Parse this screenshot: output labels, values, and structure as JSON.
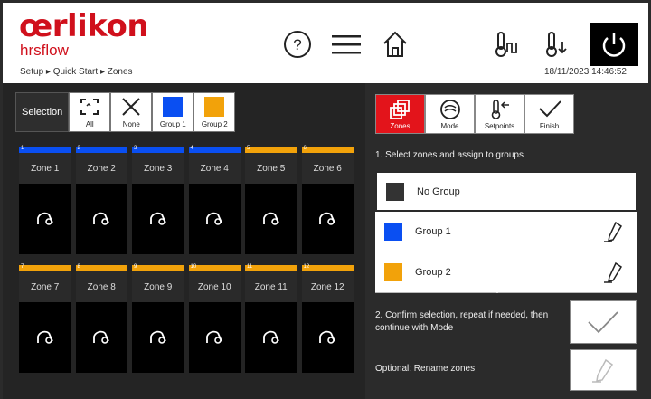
{
  "header": {
    "brand": "œrlikon",
    "product": "hrsflow",
    "breadcrumb": "Setup ▸ Quick Start ▸ Zones",
    "datetime": "18/11/2023 14:46:52"
  },
  "selection": {
    "label": "Selection",
    "buttons": [
      {
        "label": "All",
        "icon": "select-all-icon"
      },
      {
        "label": "None",
        "icon": "select-none-icon"
      },
      {
        "label": "Group 1",
        "color": "#0a4ff2"
      },
      {
        "label": "Group 2",
        "color": "#f2a20a"
      }
    ]
  },
  "colors": {
    "group1": "#0a4ff2",
    "group2": "#f2a20a",
    "accent": "#e3141b"
  },
  "zones": [
    {
      "num": "1",
      "label": "Zone 1",
      "group": "group1"
    },
    {
      "num": "2",
      "label": "Zone 2",
      "group": "group1"
    },
    {
      "num": "3",
      "label": "Zone 3",
      "group": "group1"
    },
    {
      "num": "4",
      "label": "Zone 4",
      "group": "group1"
    },
    {
      "num": "5",
      "label": "Zone 5",
      "group": "group2"
    },
    {
      "num": "6",
      "label": "Zone 6",
      "group": "group2"
    },
    {
      "num": "7",
      "label": "Zone 7",
      "group": "group2"
    },
    {
      "num": "8",
      "label": "Zone 8",
      "group": "group2"
    },
    {
      "num": "9",
      "label": "Zone 9",
      "group": "group2"
    },
    {
      "num": "10",
      "label": "Zone 10",
      "group": "group2"
    },
    {
      "num": "11",
      "label": "Zone 11",
      "group": "group2"
    },
    {
      "num": "12",
      "label": "Zone 12",
      "group": "group2"
    }
  ],
  "tabs": [
    {
      "label": "Zones",
      "icon": "zones-icon",
      "active": true
    },
    {
      "label": "Mode",
      "icon": "mode-icon",
      "active": false
    },
    {
      "label": "Setpoints",
      "icon": "setpoints-icon",
      "active": false
    },
    {
      "label": "Finish",
      "icon": "check-icon",
      "active": false
    }
  ],
  "steps": {
    "step1": "1. Select zones and assign to groups",
    "step2": "2. Confirm selection, repeat if needed, then continue with Mode",
    "step3": "Optional: Rename zones"
  },
  "groups": [
    {
      "name": "No Group",
      "color": "#333333",
      "editable": false
    },
    {
      "name": "Group 1",
      "color": "#0a4ff2",
      "editable": true
    },
    {
      "name": "Group 2",
      "color": "#f2a20a",
      "editable": true
    }
  ]
}
